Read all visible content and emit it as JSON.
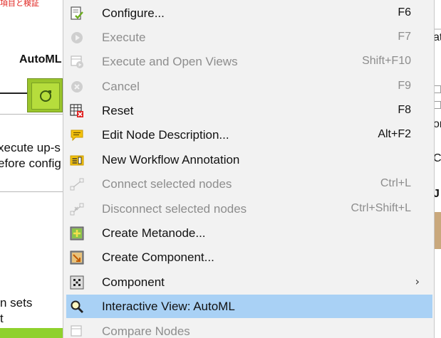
{
  "canvas": {
    "red_text": "項目と検証",
    "node_title": "AutoML",
    "tooltip_line1": "xecute up-s",
    "tooltip_line2": "efore config",
    "bottom_line1": "n sets",
    "bottom_line2": "t"
  },
  "right_panel": {
    "text_top": "at",
    "text_mid": "or",
    "text_c": "C",
    "text_j": "J"
  },
  "menu": {
    "items": [
      {
        "label": "Configure...",
        "shortcut": "F6",
        "icon": "configure-icon",
        "enabled": true
      },
      {
        "label": "Execute",
        "shortcut": "F7",
        "icon": "execute-icon",
        "enabled": false
      },
      {
        "label": "Execute and Open Views",
        "shortcut": "Shift+F10",
        "icon": "execute-open-views-icon",
        "enabled": false
      },
      {
        "label": "Cancel",
        "shortcut": "F9",
        "icon": "cancel-icon",
        "enabled": false
      },
      {
        "label": "Reset",
        "shortcut": "F8",
        "icon": "reset-icon",
        "enabled": true
      },
      {
        "label": "Edit Node Description...",
        "shortcut": "Alt+F2",
        "icon": "edit-description-icon",
        "enabled": true
      },
      {
        "label": "New Workflow Annotation",
        "shortcut": "",
        "icon": "annotation-icon",
        "enabled": true
      },
      {
        "label": "Connect selected nodes",
        "shortcut": "Ctrl+L",
        "icon": "connect-nodes-icon",
        "enabled": false
      },
      {
        "label": "Disconnect selected nodes",
        "shortcut": "Ctrl+Shift+L",
        "icon": "disconnect-nodes-icon",
        "enabled": false
      },
      {
        "label": "Create Metanode...",
        "shortcut": "",
        "icon": "metanode-icon",
        "enabled": true
      },
      {
        "label": "Create Component...",
        "shortcut": "",
        "icon": "component-create-icon",
        "enabled": true
      },
      {
        "label": "Component",
        "shortcut": "",
        "icon": "component-icon",
        "enabled": true,
        "submenu": true,
        "arrow": "›"
      },
      {
        "label": "Interactive View: AutoML",
        "shortcut": "",
        "icon": "magnifier-icon",
        "enabled": true,
        "highlighted": true
      },
      {
        "label": "Compare Nodes",
        "shortcut": "",
        "icon": "compare-nodes-icon",
        "enabled": false
      }
    ]
  },
  "colors": {
    "menu_bg": "#f2f2f2",
    "highlight": "#a9d1f5",
    "disabled_text": "#8d8d8d",
    "node_green": "#9ac52b",
    "red_text": "#e0201c"
  }
}
